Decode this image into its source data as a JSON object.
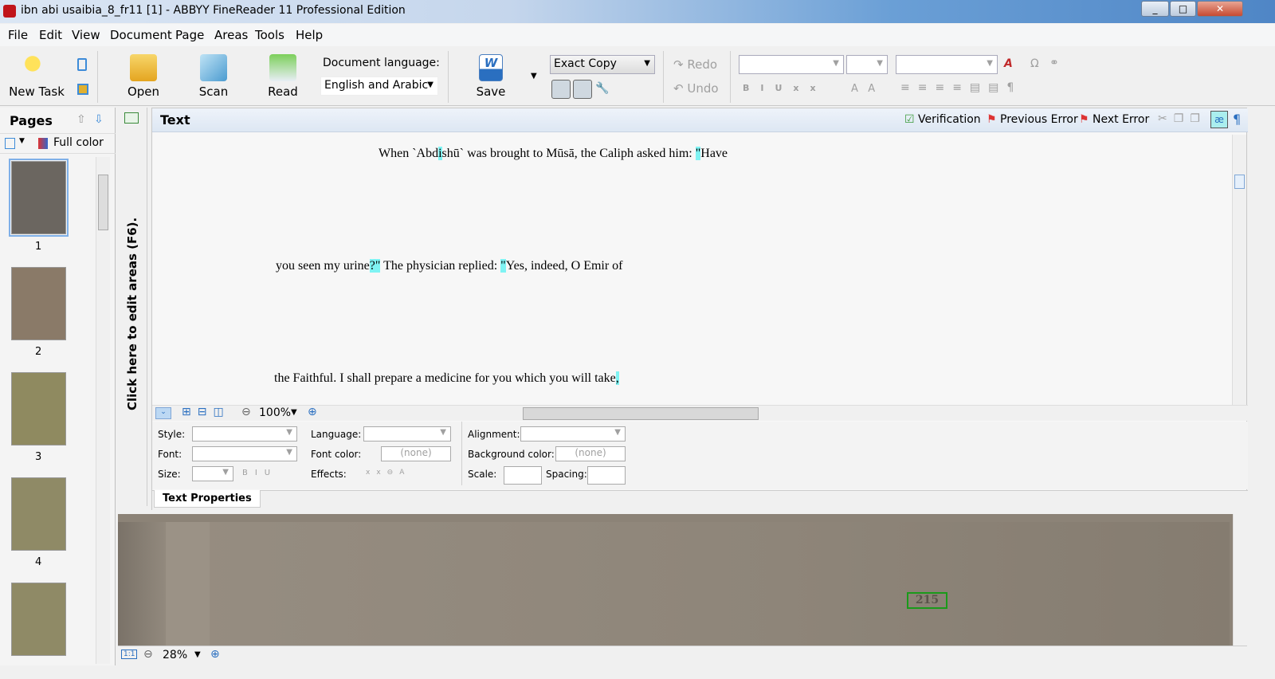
{
  "window": {
    "title": "ibn abi usaibia_8_fr11 [1] - ABBYY FineReader 11 Professional Edition",
    "min": "_",
    "max": "□",
    "close": "✕"
  },
  "menu": [
    "File",
    "Edit",
    "View",
    "Document",
    "Page",
    "Areas",
    "Tools",
    "Help"
  ],
  "toolbar": {
    "new_task": "New Task",
    "open": "Open",
    "scan": "Scan",
    "read": "Read",
    "doc_lang_label": "Document language:",
    "doc_lang_value": "English and Arabic",
    "save": "Save",
    "save_mode": "Exact Copy",
    "redo": "Redo",
    "undo": "Undo"
  },
  "pages": {
    "title": "Pages",
    "color_mode": "Full color",
    "numbers": [
      "1",
      "2",
      "3",
      "4"
    ]
  },
  "edit_areas_hint": "Click here to edit areas (F6).",
  "text_panel": {
    "title": "Text",
    "verification": "Verification",
    "previous_error": "Previous Error",
    "next_error": "Next Error",
    "lines": [
      [
        {
          "t": "When `Abd"
        },
        {
          "t": "i",
          "hl": true
        },
        {
          "t": "shū` was brought to Mūsā, the Caliph asked him: "
        },
        {
          "t": "\"",
          "hl": true
        },
        {
          "t": "Have"
        }
      ],
      [
        {
          "t": "you seen my urine"
        },
        {
          "t": "?\"",
          "hl": true
        },
        {
          "t": " The physician replied: "
        },
        {
          "t": "\"",
          "hl": true
        },
        {
          "t": "Yes, indeed, O Emir of"
        }
      ],
      [
        {
          "t": "the Faithful. I shall prepare a medicine for you which you will take"
        },
        {
          "t": ",",
          "hl": true
        }
      ]
    ],
    "zoom": "100%"
  },
  "properties": {
    "style": "Style:",
    "language": "Language:",
    "alignment": "Alignment:",
    "font": "Font:",
    "font_color": "Font color:",
    "font_color_value": "(none)",
    "background_color": "Background color:",
    "background_color_value": "(none)",
    "size": "Size:",
    "effects": "Effects:",
    "scale": "Scale:",
    "spacing": "Spacing:",
    "tab": "Text Properties"
  },
  "image_panel": {
    "zoom": "28%",
    "area_text": "215",
    "fit": "1:1"
  },
  "colors": {
    "highlight": "#7ff3f3",
    "area_border": "#1a9a1a"
  }
}
